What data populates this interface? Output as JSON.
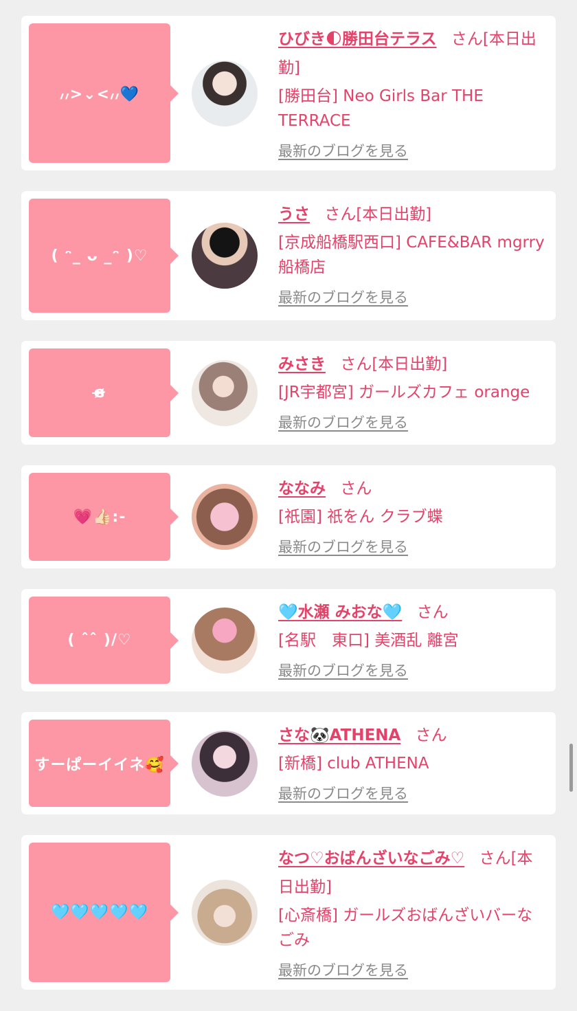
{
  "posts": [
    {
      "reaction": "៸៸>⌄<៸៸💙",
      "name": "ひびき🌓勝田台テラス",
      "suffix": "さん[本日出勤]",
      "shop": "[勝田台] Neo Girls Bar THE TERRACE",
      "blog_link": "最新のブログを見る"
    },
    {
      "reaction": "( ᵔ_ ᴗ _ᵔ )♡",
      "name": "うさ",
      "suffix": "さん[本日出勤]",
      "shop": "[京成船橋駅西口] CAFE&BAR mgrry 船橋店",
      "blog_link": "最新のブログを見る"
    },
    {
      "reaction": "ɞ̴̶̷",
      "name": "みさき",
      "suffix": "さん[本日出勤]",
      "shop": "[JR宇都宮] ガールズカフェ orange",
      "blog_link": "最新のブログを見る"
    },
    {
      "reaction": "💗👍🏻:-",
      "name": "ななみ",
      "suffix": "さん",
      "shop": "[祇園] 祇をん クラブ蝶",
      "blog_link": "最新のブログを見る"
    },
    {
      "reaction": "( ˆˆ )/♡",
      "name": "🩵水瀬 みおな🩵",
      "suffix": "さん",
      "shop": "[名駅　東口] 美酒乱 離宮",
      "blog_link": "最新のブログを見る"
    },
    {
      "reaction": "すーぱーイイネ🥰",
      "name": "さな🐼ATHENA",
      "suffix": "さん",
      "shop": "[新橋] club ATHENA",
      "blog_link": "最新のブログを見る"
    },
    {
      "reaction": "🩵🩵🩵🩵🩵",
      "name": "なつ♡おばんざいなごみ♡",
      "suffix": "さん[本日出勤]",
      "shop": "[心斎橋] ガールズおばんざいバーなごみ",
      "blog_link": "最新のブログを見る"
    }
  ],
  "colors": {
    "accent": "#e5426a",
    "bubble": "#fd97a6",
    "link_gray": "#8a8a8a",
    "background": "#efefef"
  }
}
